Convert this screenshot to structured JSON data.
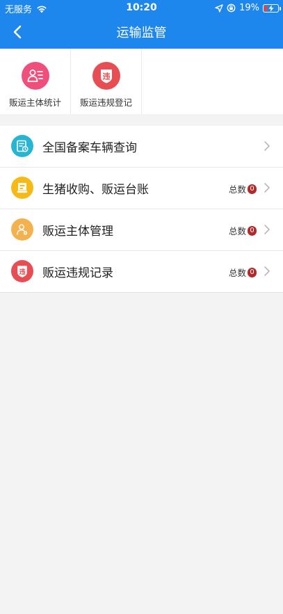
{
  "status_bar": {
    "carrier": "无服务",
    "time": "10:20",
    "battery_percent": "19%",
    "battery_level": 0.19
  },
  "nav": {
    "title": "运输监管"
  },
  "quick_actions": [
    {
      "label": "贩运主体统计",
      "icon": "person-list-icon",
      "color": "#ef4f7a"
    },
    {
      "label": "贩运违规登记",
      "icon": "violation-shield-icon",
      "color": "#e84d53",
      "glyph": "违"
    }
  ],
  "menu": [
    {
      "label": "全国备案车辆查询",
      "icon": "vehicle-record-icon",
      "color": "#26b6d4",
      "count_label": "",
      "count": ""
    },
    {
      "label": "生猪收购、贩运台账",
      "icon": "ledger-icon",
      "color": "#f7b916",
      "count_label": "总数",
      "count": "0"
    },
    {
      "label": "贩运主体管理",
      "icon": "person-settings-icon",
      "color": "#f4b24f",
      "count_label": "总数",
      "count": "0"
    },
    {
      "label": "贩运违规记录",
      "icon": "violation-shield-icon",
      "color": "#e84d53",
      "glyph": "违",
      "count_label": "总数",
      "count": "0"
    }
  ]
}
